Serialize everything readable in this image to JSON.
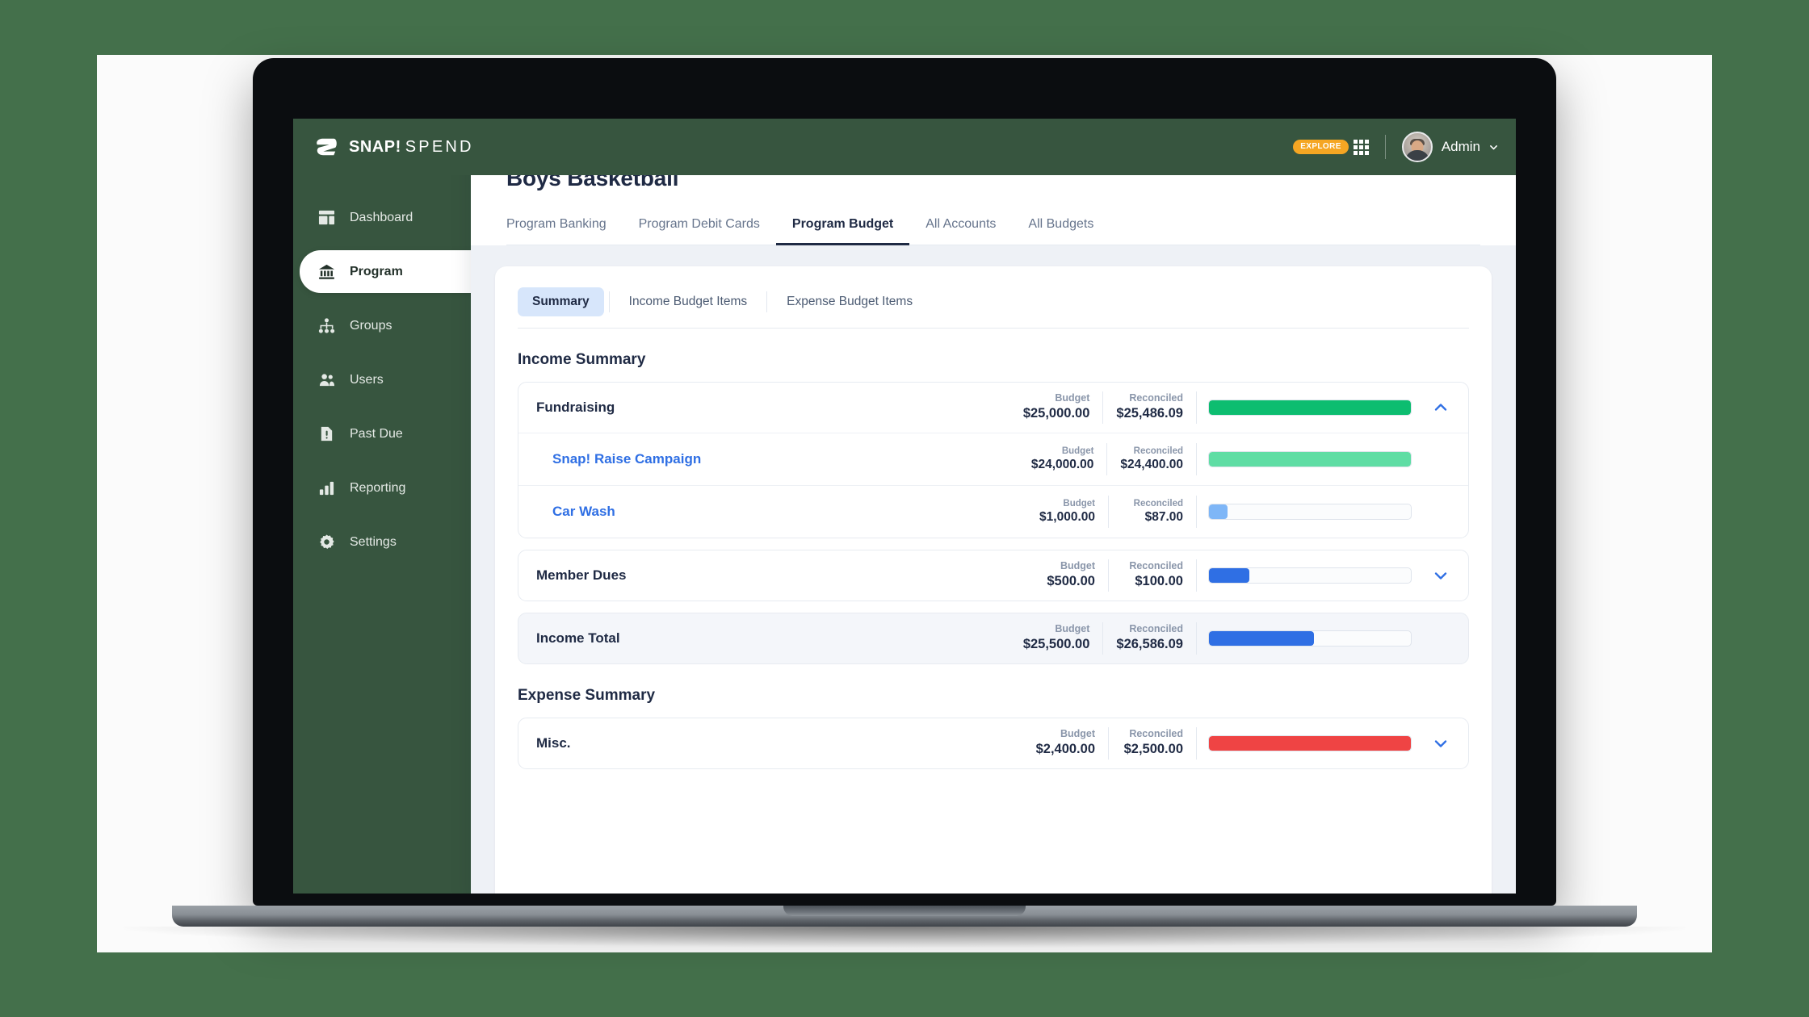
{
  "topbar": {
    "brand_main": "SNAP!",
    "brand_sub": "SPEND",
    "explore_label": "EXPLORE",
    "user_name": "Admin"
  },
  "sidebar": {
    "items": [
      {
        "label": "Dashboard",
        "icon": "dashboard-icon",
        "active": false
      },
      {
        "label": "Program",
        "icon": "bank-icon",
        "active": true
      },
      {
        "label": "Groups",
        "icon": "org-chart-icon",
        "active": false
      },
      {
        "label": "Users",
        "icon": "users-icon",
        "active": false
      },
      {
        "label": "Past Due",
        "icon": "alert-document-icon",
        "active": false
      },
      {
        "label": "Reporting",
        "icon": "bar-chart-icon",
        "active": false
      },
      {
        "label": "Settings",
        "icon": "gear-icon",
        "active": false
      }
    ]
  },
  "page": {
    "title": "Boys Basketball",
    "tabs": [
      {
        "label": "Program Banking",
        "active": false
      },
      {
        "label": "Program Debit Cards",
        "active": false
      },
      {
        "label": "Program Budget",
        "active": true
      },
      {
        "label": "All Accounts",
        "active": false
      },
      {
        "label": "All Budgets",
        "active": false
      }
    ],
    "subtabs": [
      {
        "label": "Summary",
        "active": true
      },
      {
        "label": "Income Budget Items",
        "active": false
      },
      {
        "label": "Expense Budget Items",
        "active": false
      }
    ]
  },
  "labels": {
    "budget": "Budget",
    "reconciled": "Reconciled"
  },
  "income": {
    "section_title": "Income Summary",
    "rows": [
      {
        "name": "Fundraising",
        "budget": "$25,000.00",
        "reconciled": "$25,486.09",
        "bar_percent": 100,
        "bar_color": "#0dbd70",
        "expanded": true,
        "chevron": "chevron-up-icon",
        "children": [
          {
            "name": "Snap! Raise Campaign",
            "budget": "$24,000.00",
            "reconciled": "$24,400.00",
            "bar_percent": 100,
            "bar_color": "#5fdda4"
          },
          {
            "name": "Car Wash",
            "budget": "$1,000.00",
            "reconciled": "$87.00",
            "bar_percent": 9,
            "bar_color": "#7eb6f7"
          }
        ]
      },
      {
        "name": "Member Dues",
        "budget": "$500.00",
        "reconciled": "$100.00",
        "bar_percent": 20,
        "bar_color": "#2f6fe4",
        "expanded": false,
        "chevron": "chevron-down-icon",
        "children": []
      }
    ],
    "total": {
      "name": "Income Total",
      "budget": "$25,500.00",
      "reconciled": "$26,586.09",
      "bar_percent": 52,
      "bar_color": "#2f6fe4"
    }
  },
  "expense": {
    "section_title": "Expense Summary",
    "rows": [
      {
        "name": "Misc.",
        "budget": "$2,400.00",
        "reconciled": "$2,500.00",
        "bar_percent": 100,
        "bar_color": "#ef4444",
        "expanded": false,
        "chevron": "chevron-down-icon"
      }
    ]
  },
  "colors": {
    "brand_green": "#37553f",
    "page_background": "#44704b",
    "accent_blue": "#2f6fe4",
    "accent_orange": "#f5a623",
    "positive_green": "#0dbd70",
    "negative_red": "#ef4444",
    "title_navy": "#1f2a44"
  }
}
